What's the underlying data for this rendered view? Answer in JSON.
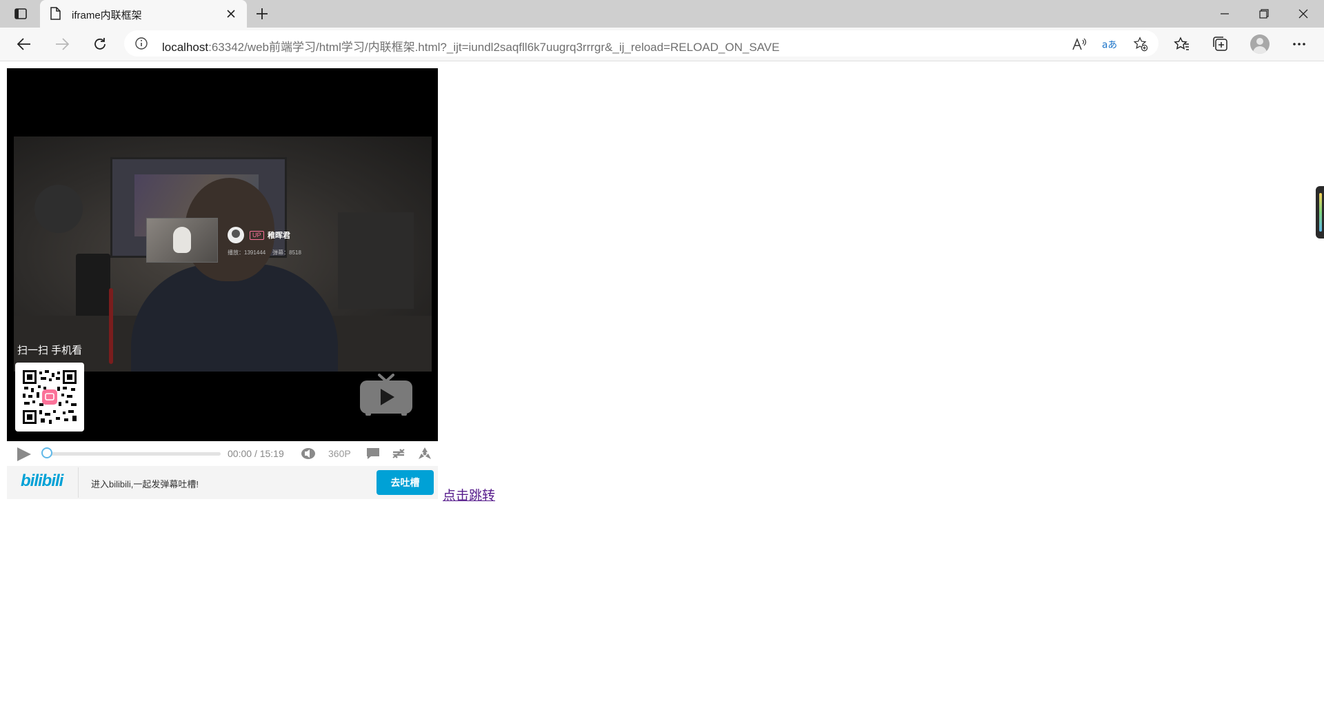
{
  "browser": {
    "tab_title": "iframe内联框架",
    "url_host": "localhost",
    "url_rest": ":63342/web前端学习/html学习/内联框架.html?_ijt=iundl2saqfll6k7uugrq3rrrgr&_ij_reload=RELOAD_ON_SAVE",
    "icons": {
      "tab_actions": "tab-actions-icon",
      "favicon": "page-icon",
      "close": "close-icon",
      "new_tab": "plus-icon",
      "minimize": "minimize-icon",
      "restore": "restore-icon",
      "window_close": "close-icon",
      "back": "back-arrow-icon",
      "forward": "forward-arrow-icon",
      "refresh": "refresh-icon",
      "site_info": "info-icon",
      "read_aloud": "read-aloud-icon",
      "translate": "translate-icon",
      "add_favorite": "star-add-icon",
      "favorites": "favorites-icon",
      "collections": "collections-icon",
      "profile": "profile-avatar",
      "more": "more-icon"
    }
  },
  "page": {
    "video": {
      "up_badge": "UP",
      "up_name": "稚晖君",
      "stat_plays": "播放：1391444",
      "stat_danmaku": "弹幕：8518",
      "scan_label": "扫一扫 手机看"
    },
    "player": {
      "current_time": "00:00",
      "separator": "/",
      "duration": "15:19",
      "quality": "360P",
      "progress": 0
    },
    "danmaku": {
      "logo": "bilibili",
      "hint": "进入bilibili,一起发弹幕吐槽!",
      "button": "去吐槽"
    },
    "link_text": "点击跳转"
  },
  "colors": {
    "accent": "#00a1d6",
    "up_badge": "#fb7299",
    "visited_link": "#551a8b"
  }
}
